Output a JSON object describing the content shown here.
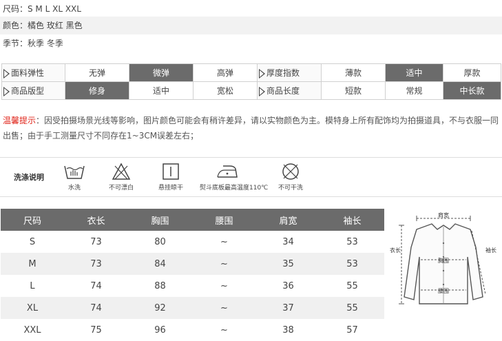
{
  "info": {
    "size": "尺码：S M L XL XXL",
    "color": "颜色：橘色 玫红 黑色",
    "season": "季节：秋季 冬季"
  },
  "attributes": {
    "row1": {
      "elasticity_label": "面料弹性",
      "elasticity_options": [
        "无弹",
        "微弹",
        "高弹"
      ],
      "elasticity_selected": "微弹",
      "thickness_label": "厚度指数",
      "thickness_options": [
        "薄款",
        "适中",
        "厚款"
      ],
      "thickness_selected": "适中"
    },
    "row2": {
      "fit_label": "商品版型",
      "fit_options": [
        "修身",
        "适中",
        "宽松"
      ],
      "fit_selected": "修身",
      "length_label": "商品长度",
      "length_options": [
        "短款",
        "常规",
        "中长款"
      ],
      "length_selected": "中长款"
    }
  },
  "tip": {
    "label": "温馨提示",
    "text": "：因受拍摄场景光线等影响，图片颜色可能会有稍许差异，请以实物颜色为主。模特身上所有配饰均为拍摄道具，不与衣服一同出售；由于手工测量尺寸不同存在1~3CM误差左右；"
  },
  "washing": {
    "title": "洗涤说明",
    "items": [
      {
        "icon": "hand-wash-icon",
        "label": "水洗"
      },
      {
        "icon": "no-bleach-icon",
        "label": "不可漂白"
      },
      {
        "icon": "hang-dry-icon",
        "label": "悬挂晾干"
      },
      {
        "icon": "iron-icon",
        "label": "熨斗底板最高温度110℃"
      },
      {
        "icon": "no-dry-clean-icon",
        "label": "不可干洗"
      }
    ]
  },
  "size_table": {
    "headers": [
      "尺码",
      "衣长",
      "胸围",
      "腰围",
      "肩宽",
      "袖长"
    ],
    "rows": [
      [
        "S",
        "73",
        "80",
        "~",
        "34",
        "53"
      ],
      [
        "M",
        "73",
        "84",
        "~",
        "35",
        "53"
      ],
      [
        "L",
        "74",
        "88",
        "~",
        "36",
        "55"
      ],
      [
        "XL",
        "74",
        "92",
        "~",
        "37",
        "55"
      ],
      [
        "XXL",
        "75",
        "96",
        "~",
        "38",
        "57"
      ]
    ]
  },
  "diagram": {
    "shoulder": "肩宽",
    "length": "衣长",
    "chest": "胸围",
    "sleeve": "袖长",
    "waist": "腰围"
  }
}
